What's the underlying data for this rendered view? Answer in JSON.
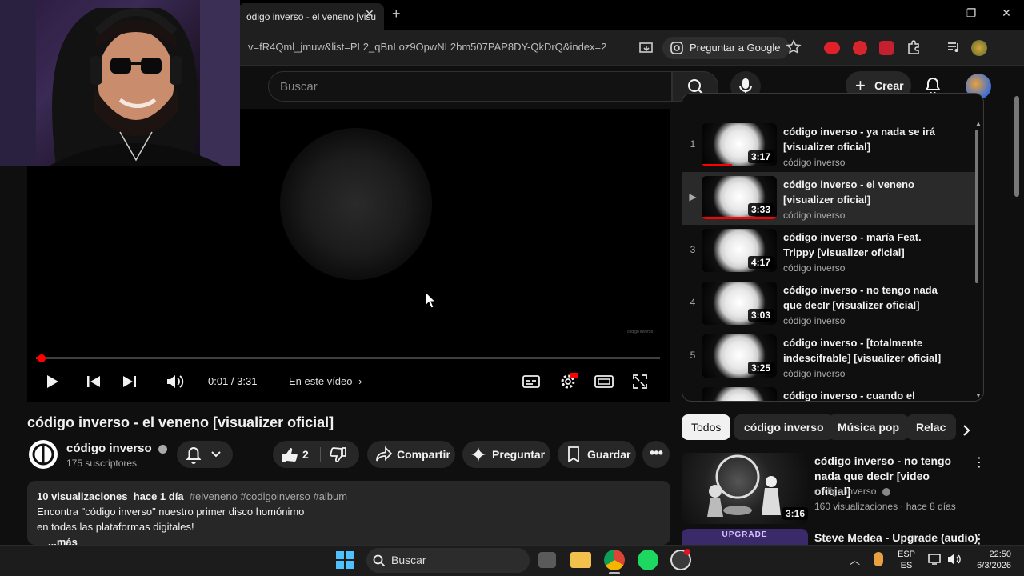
{
  "browser": {
    "tab_title": "ódigo inverso - el veneno [visu",
    "url": "v=fR4Qml_jmuw&list=PL2_qBnLoz9OpwNL2bm507PAP8DY-QkDrQ&index=2",
    "ask_google": "Preguntar a Google"
  },
  "header": {
    "search_placeholder": "Buscar",
    "create_label": "Crear"
  },
  "player": {
    "time": "0:01 / 3:31",
    "chapters_label": "En este vídeo",
    "watermark": "código inverso",
    "progress_fraction": 0.003
  },
  "video": {
    "title": "código inverso - el veneno [visualizer oficial]",
    "channel": "código inverso",
    "subscribers": "175 suscriptores",
    "likes": "2",
    "share_label": "Compartir",
    "ask_label": "Preguntar",
    "save_label": "Guardar"
  },
  "description": {
    "views": "10 visualizaciones",
    "date": "hace 1 día",
    "tags": "#elveneno #codigoinverso #album",
    "line1": "Encontra \"código inverso\" nuestro primer disco homónimo",
    "line2": "en todas las plataformas digitales!",
    "more": "...más"
  },
  "playlist": {
    "items": [
      {
        "index": "1",
        "title": "código inverso - ya nada se irá [visualizer oficial]",
        "channel": "código inverso",
        "duration": "3:17"
      },
      {
        "index": "▶",
        "title": "código inverso - el veneno [visualizer oficial]",
        "channel": "código inverso",
        "duration": "3:33"
      },
      {
        "index": "3",
        "title": "código inverso - maría Feat. Trippy [visualizer oficial]",
        "channel": "código inverso",
        "duration": "4:17"
      },
      {
        "index": "4",
        "title": "código inverso - no tengo nada que decIr [visualizer oficial]",
        "channel": "código inverso",
        "duration": "3:03"
      },
      {
        "index": "5",
        "title": "código inverso - [totalmente indescifrable] [visualizer oficial]",
        "channel": "código inverso",
        "duration": "3:25"
      },
      {
        "index": "",
        "title": "código inverso - cuando el",
        "channel": "",
        "duration": ""
      }
    ]
  },
  "chips": [
    "Todos",
    "código inverso",
    "Música pop",
    "Relac"
  ],
  "recommendations": [
    {
      "title": "código inverso - no tengo nada que decIr [video oficial]",
      "channel": "código inverso",
      "stats": "160 visualizaciones · hace 8 días",
      "duration": "3:16"
    },
    {
      "title": "Steve Medea - Upgrade (audio)",
      "thumb_text": "UPGRADE"
    }
  ],
  "taskbar": {
    "search_label": "Buscar",
    "lang_top": "ESP",
    "lang_bottom": "ES",
    "time": "22:50",
    "date": "6/3/2026"
  },
  "colors": {
    "background": "#0f0f0f",
    "accent_red": "#ff0000",
    "surface": "#272727"
  }
}
